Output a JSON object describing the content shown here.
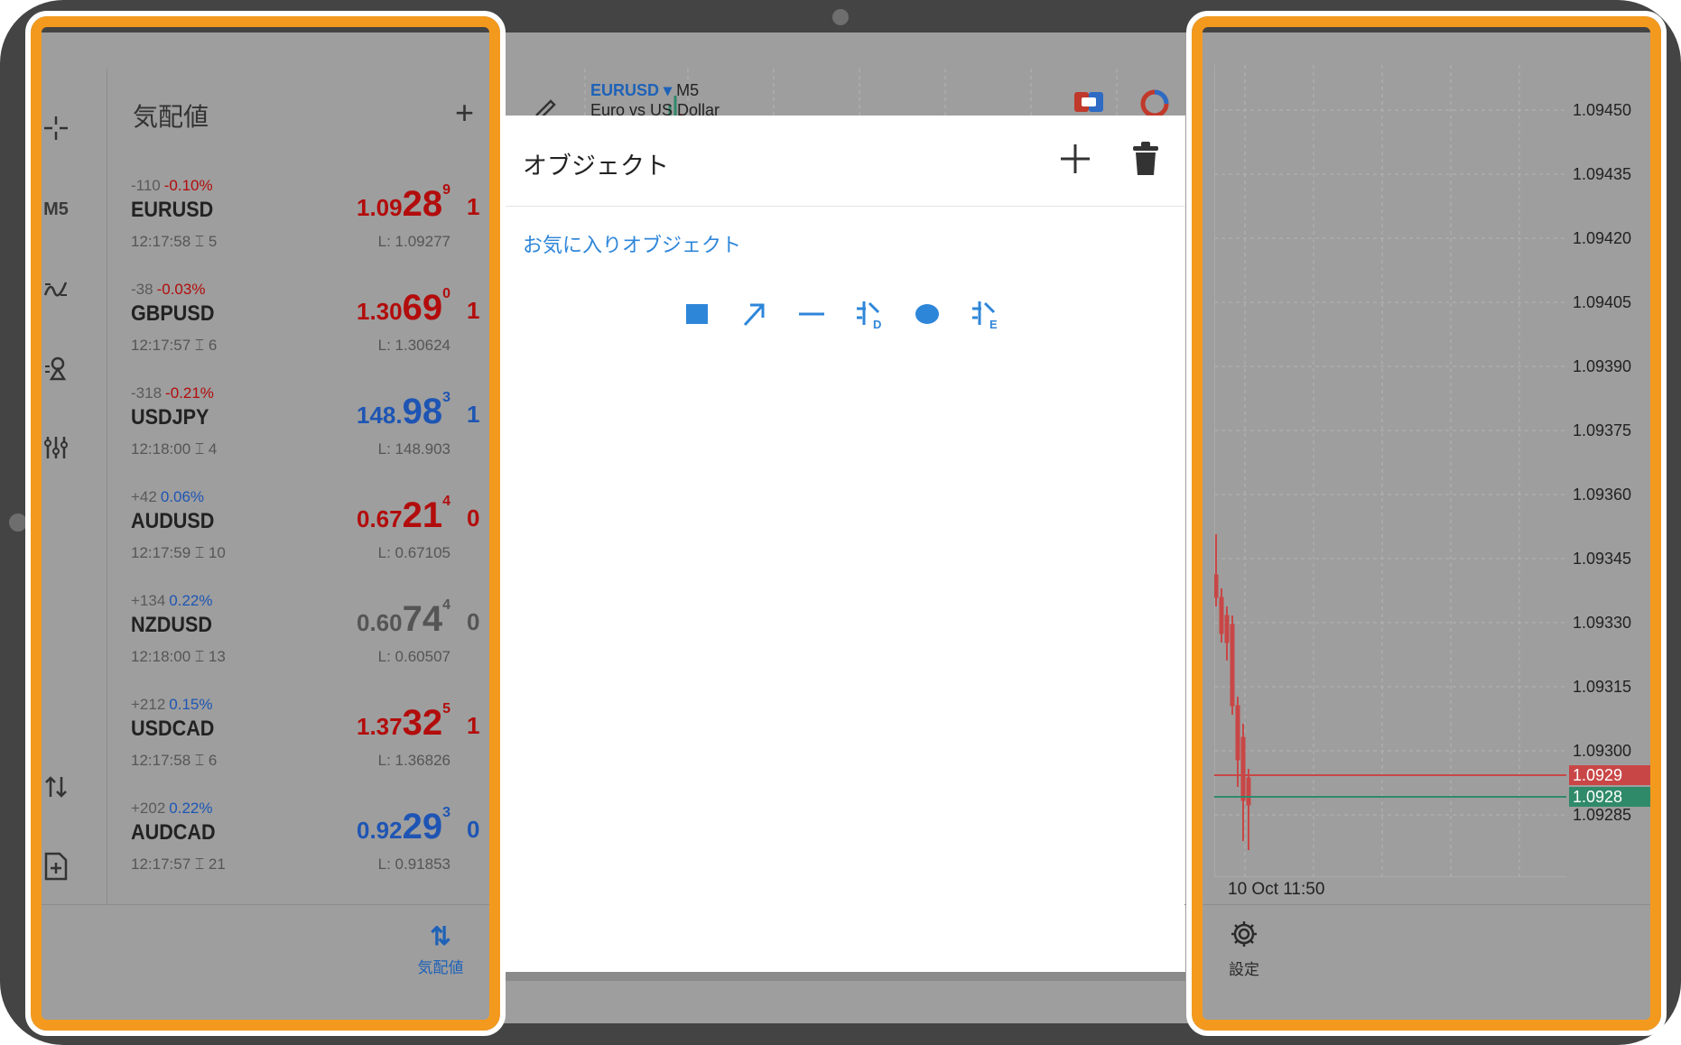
{
  "watchlist": {
    "title": "気配値",
    "rows": [
      {
        "change": "-110",
        "change_pct": "-0.10%",
        "pct_color": "#b30c0c",
        "symbol": "EURUSD",
        "time": "12:17:58",
        "spread": "5",
        "price_main": "1.09",
        "price_big": "28",
        "price_sup": "9",
        "price_color": "#b30c0c",
        "low": "L: 1.09277",
        "edge_char": "1"
      },
      {
        "change": "-38",
        "change_pct": "-0.03%",
        "pct_color": "#b30c0c",
        "symbol": "GBPUSD",
        "time": "12:17:57",
        "spread": "6",
        "price_main": "1.30",
        "price_big": "69",
        "price_sup": "0",
        "price_color": "#b30c0c",
        "low": "L: 1.30624",
        "edge_char": "1"
      },
      {
        "change": "-318",
        "change_pct": "-0.21%",
        "pct_color": "#b30c0c",
        "symbol": "USDJPY",
        "time": "12:18:00",
        "spread": "4",
        "price_main": "148.",
        "price_big": "98",
        "price_sup": "3",
        "price_color": "#1e55b4",
        "low": "L: 148.903",
        "edge_char": "1"
      },
      {
        "change": "+42",
        "change_pct": "0.06%",
        "pct_color": "#1e55b4",
        "symbol": "AUDUSD",
        "time": "12:17:59",
        "spread": "10",
        "price_main": "0.67",
        "price_big": "21",
        "price_sup": "4",
        "price_color": "#b30c0c",
        "low": "L: 0.67105",
        "edge_char": "0"
      },
      {
        "change": "+134",
        "change_pct": "0.22%",
        "pct_color": "#1e55b4",
        "symbol": "NZDUSD",
        "time": "12:18:00",
        "spread": "13",
        "price_main": "0.60",
        "price_big": "74",
        "price_sup": "4",
        "price_color": "#555555",
        "low": "L: 0.60507",
        "edge_char": "0"
      },
      {
        "change": "+212",
        "change_pct": "0.15%",
        "pct_color": "#1e55b4",
        "symbol": "USDCAD",
        "time": "12:17:58",
        "spread": "6",
        "price_main": "1.37",
        "price_big": "32",
        "price_sup": "5",
        "price_color": "#b30c0c",
        "low": "L: 1.36826",
        "edge_char": "1"
      },
      {
        "change": "+202",
        "change_pct": "0.22%",
        "pct_color": "#1e55b4",
        "symbol": "AUDCAD",
        "time": "12:17:57",
        "spread": "21",
        "price_main": "0.92",
        "price_big": "29",
        "price_sup": "3",
        "price_color": "#1e55b4",
        "low": "L: 0.91853",
        "edge_char": "0"
      }
    ],
    "bottom_button_label": "気配値"
  },
  "toolstrip": {
    "timeframe": "M5",
    "icons": [
      "crosshair-icon",
      "indicator-icon",
      "objects-icon",
      "settings-sliders-icon",
      "trade-icon",
      "new-order-icon"
    ]
  },
  "chart_header": {
    "symbol": "EURUSD",
    "dropdown_glyph": "▾",
    "timeframe": "M5",
    "description": "Euro vs US Dollar"
  },
  "objects_dialog": {
    "title": "オブジェクト",
    "add_icon": "plus-icon",
    "delete_icon": "trash-icon",
    "favorites_label": "お気に入りオブジェクト",
    "favorite_icons": [
      "rectangle-icon",
      "arrow-icon",
      "horizontal-line-icon",
      "fibo-d-icon",
      "ellipse-icon",
      "fibo-e-icon"
    ],
    "accent_color": "#2e86d9"
  },
  "chart": {
    "y_labels": [
      "1.09450",
      "1.09435",
      "1.09420",
      "1.09405",
      "1.09390",
      "1.09375",
      "1.09360",
      "1.09345",
      "1.09330",
      "1.09315",
      "1.09300",
      "1.09285"
    ],
    "bid_flag": "1.0929",
    "ask_flag": "1.0928",
    "bid_color": "#c94646",
    "ask_color": "#2f8a6a",
    "x_label": "10 Oct 11:50",
    "settings_label": "設定"
  },
  "highlight_color": "#f39a1e"
}
